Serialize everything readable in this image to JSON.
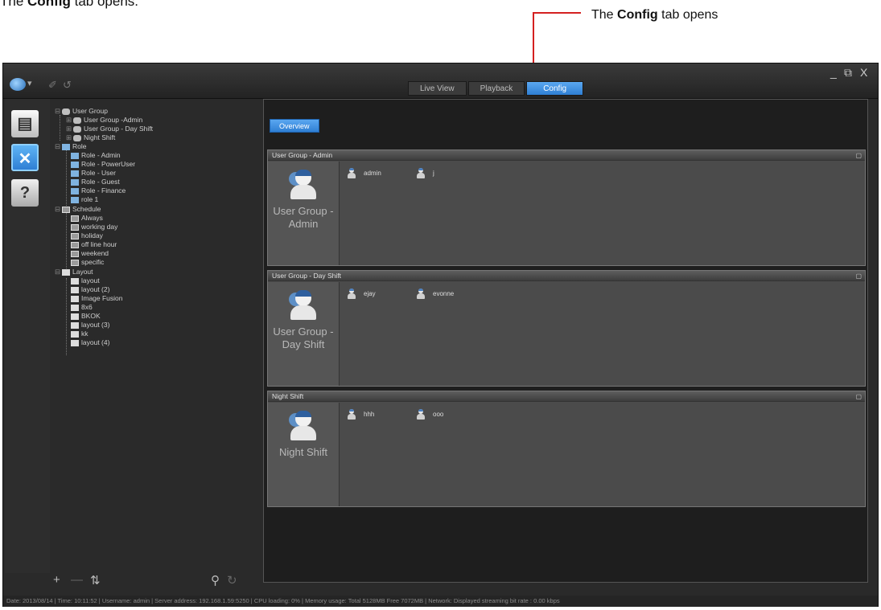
{
  "doc": {
    "caption_prefix": "The",
    "caption_bold": "Config",
    "caption_suffix": "tab opens.",
    "callout_prefix": "The",
    "callout_bold": "Config",
    "callout_suffix": "tab opens",
    "callout_color": "#d42020"
  },
  "topbar": {
    "tabs": [
      {
        "label": "Live View",
        "active": false
      },
      {
        "label": "Playback",
        "active": false
      },
      {
        "label": "Config",
        "active": true
      }
    ],
    "window_controls": [
      "_",
      "⧉",
      "X"
    ]
  },
  "leftnav": {
    "icons": [
      "monitor-icon",
      "config-tools-icon",
      "help-icon"
    ]
  },
  "tree": {
    "user_group_root": "User Group",
    "user_groups": [
      "User Group -Admin",
      "User Group - Day Shift",
      "Night Shift"
    ],
    "role_root": "Role",
    "roles": [
      "Role - Admin",
      "Role - PowerUser",
      "Role - User",
      "Role - Guest",
      "Role - Finance",
      "role 1"
    ],
    "schedule_root": "Schedule",
    "schedules": [
      "Always",
      "working day",
      "holiday",
      "off line hour",
      "weekend",
      "specific"
    ],
    "layout_root": "Layout",
    "layouts": [
      "layout",
      "layout (2)",
      "Image Fusion",
      "8x6",
      "BKOK",
      "layout (3)",
      "kk",
      "layout (4)"
    ],
    "bottom_tools": [
      "+",
      "—",
      "⇅",
      "⚲",
      "↻"
    ]
  },
  "main": {
    "overview_label": "Overview",
    "panels": [
      {
        "header": "User Group - Admin",
        "card_name": "User Group - Admin",
        "users": [
          "admin",
          "j"
        ]
      },
      {
        "header": "User Group - Day Shift",
        "card_name": "User Group - Day Shift",
        "users": [
          "ejay",
          "evonne"
        ]
      },
      {
        "header": "Night Shift",
        "card_name": "Night Shift",
        "users": [
          "hhh",
          "ooo"
        ]
      }
    ]
  },
  "status": {
    "text": "Date: 2013/08/14 | Time: 10:11:52 | Username: admin | Server address: 192.168.1.59:5250 | CPU loading: 0% | Memory usage: Total 5128MB Free 7072MB | Network: Displayed streaming bit rate : 0.00 kbps"
  },
  "colors": {
    "accent": "#2f7fd4",
    "background": "#2a2a2a"
  }
}
